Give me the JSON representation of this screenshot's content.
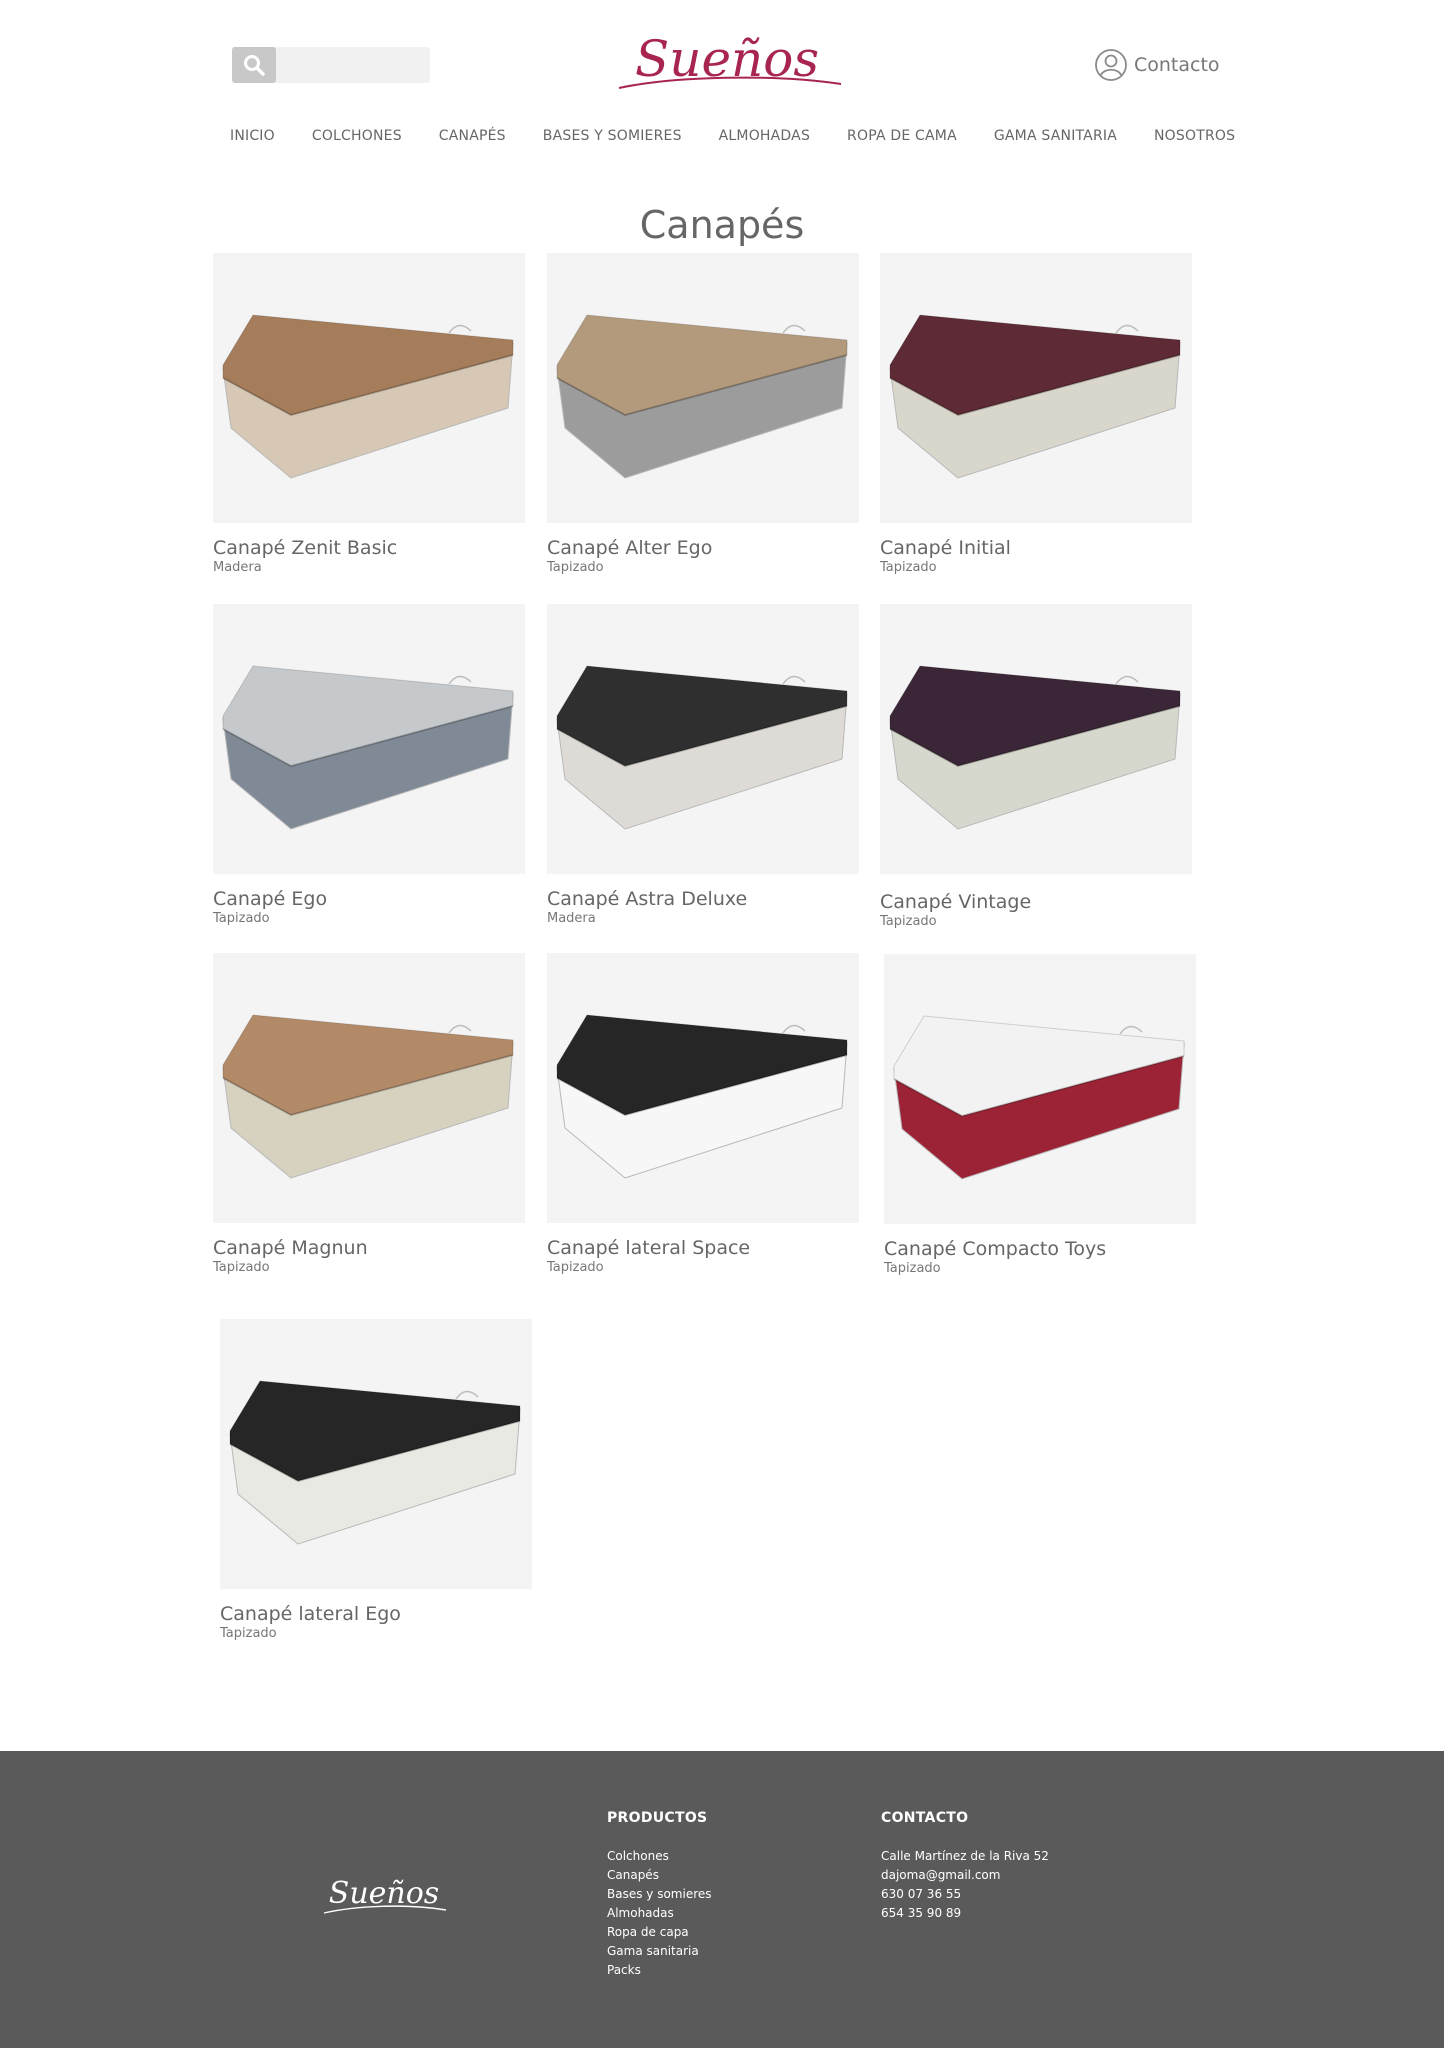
{
  "header": {
    "search_placeholder": "",
    "brand": "Sueños",
    "contact_label": "Contacto"
  },
  "nav": [
    "INICIO",
    "COLCHONES",
    "CANAPÉS",
    "BASES Y SOMIERES",
    "ALMOHADAS",
    "ROPA DE CAMA",
    "GAMA SANITARIA",
    "NOSOTROS"
  ],
  "page_title": "Canapés",
  "products": [
    {
      "name": "Canapé Zenit Basic",
      "category": "Madera",
      "top_color": "#a57d5b",
      "base_color": "#d6c8b4"
    },
    {
      "name": "Canapé Alter Ego",
      "category": "Tapizado",
      "top_color": "#b39a7d",
      "base_color": "#9c9c9c"
    },
    {
      "name": "Canapé Initial",
      "category": "Tapizado",
      "top_color": "#5d2a35",
      "base_color": "#d9d6cb"
    },
    {
      "name": "Canapé Ego",
      "category": "Tapizado",
      "top_color": "#c6c9cc",
      "base_color": "#7f8a96"
    },
    {
      "name": "Canapé Astra Deluxe",
      "category": "Madera",
      "top_color": "#2f2f2f",
      "base_color": "#dedbd6"
    },
    {
      "name": "Canapé Vintage",
      "category": "Tapizado",
      "top_color": "#3a2636",
      "base_color": "#d7d8cd"
    },
    {
      "name": "Canapé Magnun",
      "category": "Tapizado",
      "top_color": "#b28a68",
      "base_color": "#d7d2c0"
    },
    {
      "name": "Canapé lateral Space",
      "category": "Tapizado",
      "top_color": "#262626",
      "base_color": "#f7f7f7"
    },
    {
      "name": "Canapé Compacto Toys",
      "category": "Tapizado",
      "top_color": "#f2f2f2",
      "base_color": "#9b2335"
    },
    {
      "name": "Canapé lateral Ego",
      "category": "Tapizado",
      "top_color": "#262626",
      "base_color": "#e9e9e4"
    }
  ],
  "footer": {
    "brand": "Sueños",
    "productos_heading": "PRODUCTOS",
    "productos": [
      "Colchones",
      "Canapés",
      "Bases y somieres",
      "Almohadas",
      "Ropa de capa",
      "Gama sanitaria",
      "Packs"
    ],
    "contacto_heading": "CONTACTO",
    "contacto": [
      "Calle Martínez de la Riva 52",
      "dajoma@gmail.com",
      "630 07 36 55",
      "654 35 90 89"
    ]
  },
  "colors": {
    "brand": "#a8254f",
    "footer_bg": "#5a5a5a",
    "card_bg": "#f4f4f4"
  }
}
